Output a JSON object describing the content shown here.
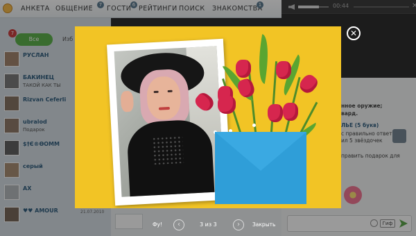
{
  "top_nav": {
    "items": [
      {
        "label": "АНКЕТА",
        "badge": ""
      },
      {
        "label": "ОБЩЕНИЕ",
        "badge": "7"
      },
      {
        "label": "ГОСТИ",
        "badge": "6"
      },
      {
        "label": "РЕЙТИНГИ",
        "badge": ""
      },
      {
        "label": "ПОИСК",
        "badge": ""
      },
      {
        "label": "ЗНАКОМСТВА",
        "badge": "1"
      }
    ]
  },
  "player": {
    "time": "00:44"
  },
  "left_panel": {
    "notif_count": "7",
    "tab_all": "Все",
    "tab_fav": "Изб",
    "users": [
      {
        "name": "РУСЛАН",
        "sub": ""
      },
      {
        "name": "БАКИНЕЦ",
        "sub": "ТАКОЙ КАК ТЫ"
      },
      {
        "name": "Rizvan Ceferli",
        "sub": ""
      },
      {
        "name": "ubralod",
        "sub": "Подарок"
      },
      {
        "name": "$†Є®ѲОММ",
        "sub": ""
      },
      {
        "name": "серый",
        "sub": ""
      },
      {
        "name": "AX",
        "sub": ""
      },
      {
        "name": "♥♥ AMOUR",
        "sub": ""
      }
    ],
    "bottom_time": "21.07.2010"
  },
  "right_panel": {
    "lines": [
      "нное оружие;",
      "вард.",
      "ЛЬЕ (5 букв)",
      "с правильно ответил",
      "ил 5 звёздочек",
      "править подарок для"
    ],
    "gif_label": "Гиф"
  },
  "viewer": {
    "fu_label": "Фу!",
    "counter": "3 из 3",
    "close_label": "Закрыть"
  }
}
